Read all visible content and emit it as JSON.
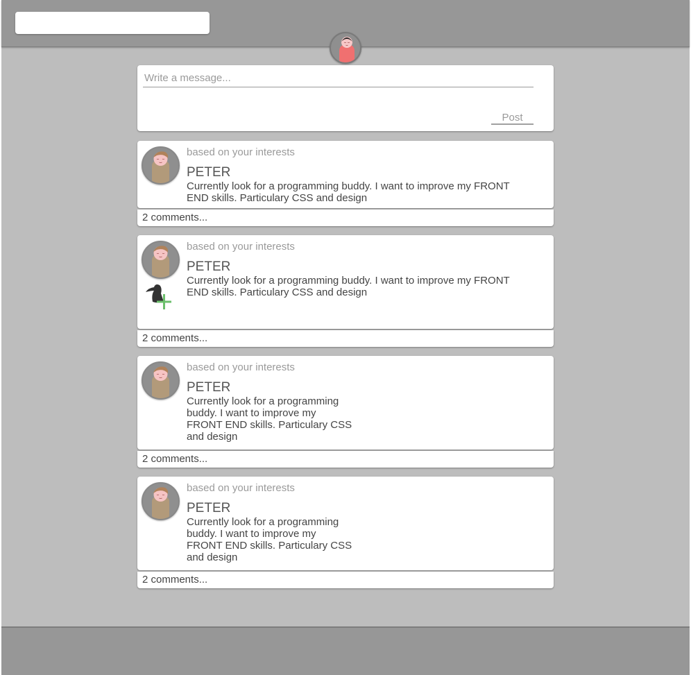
{
  "header": {
    "search": {
      "value": "",
      "placeholder": ""
    }
  },
  "composer": {
    "placeholder": "Write a message...",
    "post_label": "Post"
  },
  "posts": [
    {
      "interest_label": "based on your interests",
      "name": "PETER",
      "message": "Currently look for a programming buddy. I want to improve my FRONT END skills. Particulary CSS and design",
      "comments_label": "2 comments..."
    },
    {
      "interest_label": "based on your interests",
      "name": "PETER",
      "message": "Currently look for a programming buddy. I want to improve my FRONT END skills. Particulary CSS and design",
      "comments_label": "2 comments...",
      "add_friend_icon": "add-friend-icon"
    },
    {
      "interest_label": "based on your interests",
      "name": "PETER",
      "message": "Currently look for a programming buddy. I want to improve my FRONT END skills. Particulary CSS and design",
      "comments_label": "2 comments..."
    },
    {
      "interest_label": "based on your interests",
      "name": "PETER",
      "message": "Currently look for a programming buddy. I want to improve my FRONT END skills. Particulary CSS and design",
      "comments_label": "2 comments..."
    }
  ],
  "colors": {
    "page_background": "#bdbdbd",
    "bar_background": "#979797",
    "card_background": "#ffffff",
    "add_friend_plus": "#6cbf6c",
    "user_shirt": "#f07070"
  }
}
